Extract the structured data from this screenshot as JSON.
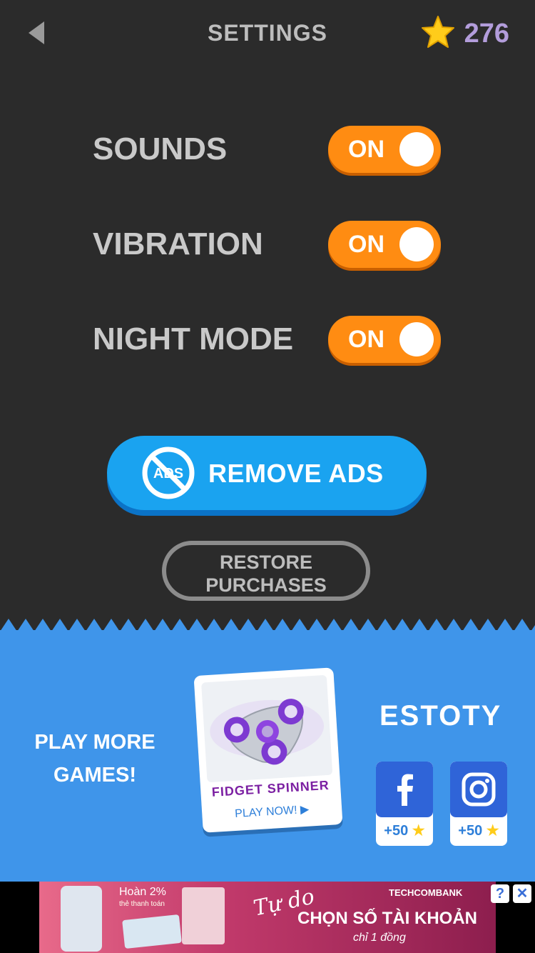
{
  "header": {
    "title": "SETTINGS",
    "coin_count": "276",
    "back_icon": "back-arrow-icon",
    "coin_icon": "star-icon"
  },
  "settings": [
    {
      "label": "SOUNDS",
      "state": "ON"
    },
    {
      "label": "VIBRATION",
      "state": "ON"
    },
    {
      "label": "NIGHT MODE",
      "state": "ON"
    }
  ],
  "actions": {
    "remove_ads_label": "REMOVE ADS",
    "remove_ads_icon_text": "ADS",
    "restore_label": "RESTORE\nPURCHASES"
  },
  "promo": {
    "play_more_label": "PLAY MORE\nGAMES!",
    "game_name": "FIDGET SPINNER",
    "game_cta": "PLAY NOW!",
    "brand": "ESTOTY",
    "social": [
      {
        "name": "facebook",
        "reward": "+50"
      },
      {
        "name": "instagram",
        "reward": "+50"
      }
    ]
  },
  "ad": {
    "text_cashback": "Hoàn 2%",
    "text_cashback_sub": "thẻ thanh toán",
    "script": "Tự do",
    "bank": "TECHCOMBANK",
    "headline": "CHỌN SỐ TÀI KHOẢN",
    "sub": "chỉ 1 đồng",
    "info_label": "?",
    "close_label": "✕"
  },
  "colors": {
    "background": "#2b2b2b",
    "toggle_on": "#ff8c12",
    "remove_ads": "#1aa3f0",
    "promo_bg": "#3f95ea",
    "coin_text": "#b39ddb"
  }
}
